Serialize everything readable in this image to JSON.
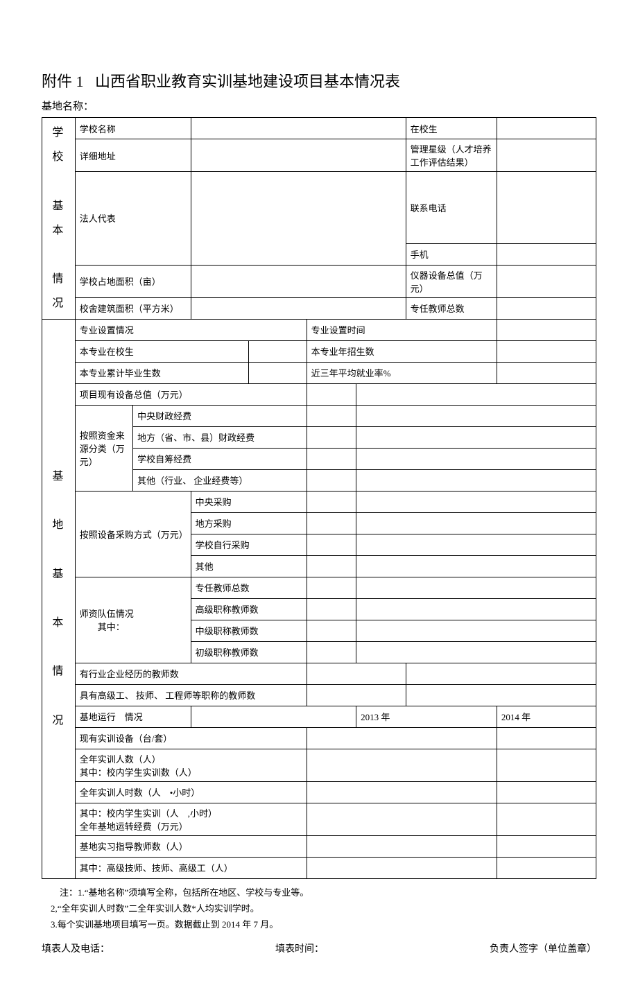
{
  "title_prefix": "附件 1",
  "title_main": "山西省职业教育实训基地建设项目基本情况表",
  "base_name_label": "基地名称：",
  "section_school": "学校基本情况",
  "section_base": "基地基本情况",
  "rows": {
    "school_name": "学校名称",
    "students_in": "在校生",
    "detail_addr": "详细地址",
    "mgmt_star": "管理星级（人才培养工作评估结果）",
    "legal_rep": "法人代表",
    "contact_tel": "联系电话",
    "mobile": "手机",
    "land_area": "学校占地面积（亩）",
    "equip_total": "仪器设备总值（万元）",
    "building_area": "校舍建筑面积（平方米）",
    "fulltime_teachers": "专任教师总数",
    "major_setting": "专业设置情况",
    "major_time": "专业设置时间",
    "major_students": "本专业在校生",
    "major_recruit": "本专业年招生数",
    "major_grad": "本专业累计毕业生数",
    "avg_employ": "近三年平均就业率%",
    "proj_equip_val": "项目现有设备总值（万元）",
    "fund_source": "按照资金来源分类（万元）",
    "fund_central": "中央财政经费",
    "fund_local": "地方（省、市、县）财政经费",
    "fund_school": "学校自筹经费",
    "fund_other": "其他（行业、 企业经费等）",
    "purchase_method": "按照设备采购方式（万元）",
    "purchase_central": "中央采购",
    "purchase_local": "地方采购",
    "purchase_school": "学校自行采购",
    "purchase_other": "其他",
    "faculty_situation": "师资队伍情况",
    "faculty_sub": "其中：",
    "t_fulltime": "专任教师总数",
    "t_senior": "高级职称教师数",
    "t_mid": "中级职称教师数",
    "t_junior": "初级职称教师数",
    "t_industry": "有行业企业经历的教师数",
    "t_skill": "具有高级工、 技师、 工程师等职称的教师数",
    "op_label": "基地运行 情况",
    "year1": "2013 年",
    "year2": "2014 年",
    "equip_sets": "现有实训设备（台/套）",
    "train_people": "全年实训人数（人）",
    "train_in_students": "其中：校内学生实训数（人）",
    "train_hours": "全年实训人时数（人 •小时）",
    "train_in_hours": "其中：校内学生实训（人 ,小时）",
    "op_fund": "全年基地运转经费（万元）",
    "guide_teachers": "基地实习指导教师数（人）",
    "guide_senior": "其中：高级技师、技师、高级工（人）"
  },
  "notes": {
    "n1": "注：1.“基地名称”须填写全称，包括所在地区、学校与专业等。",
    "n2": "2,“全年实训人时数”二全年实训人数*人均实训学时。",
    "n3": "3.每个实训基地项目填写一页。数据截止到 2014 年 7 月。"
  },
  "footer": {
    "filler": "填表人及电话：",
    "time": "填表时间：",
    "sign": "负责人签字（单位盖章）"
  }
}
